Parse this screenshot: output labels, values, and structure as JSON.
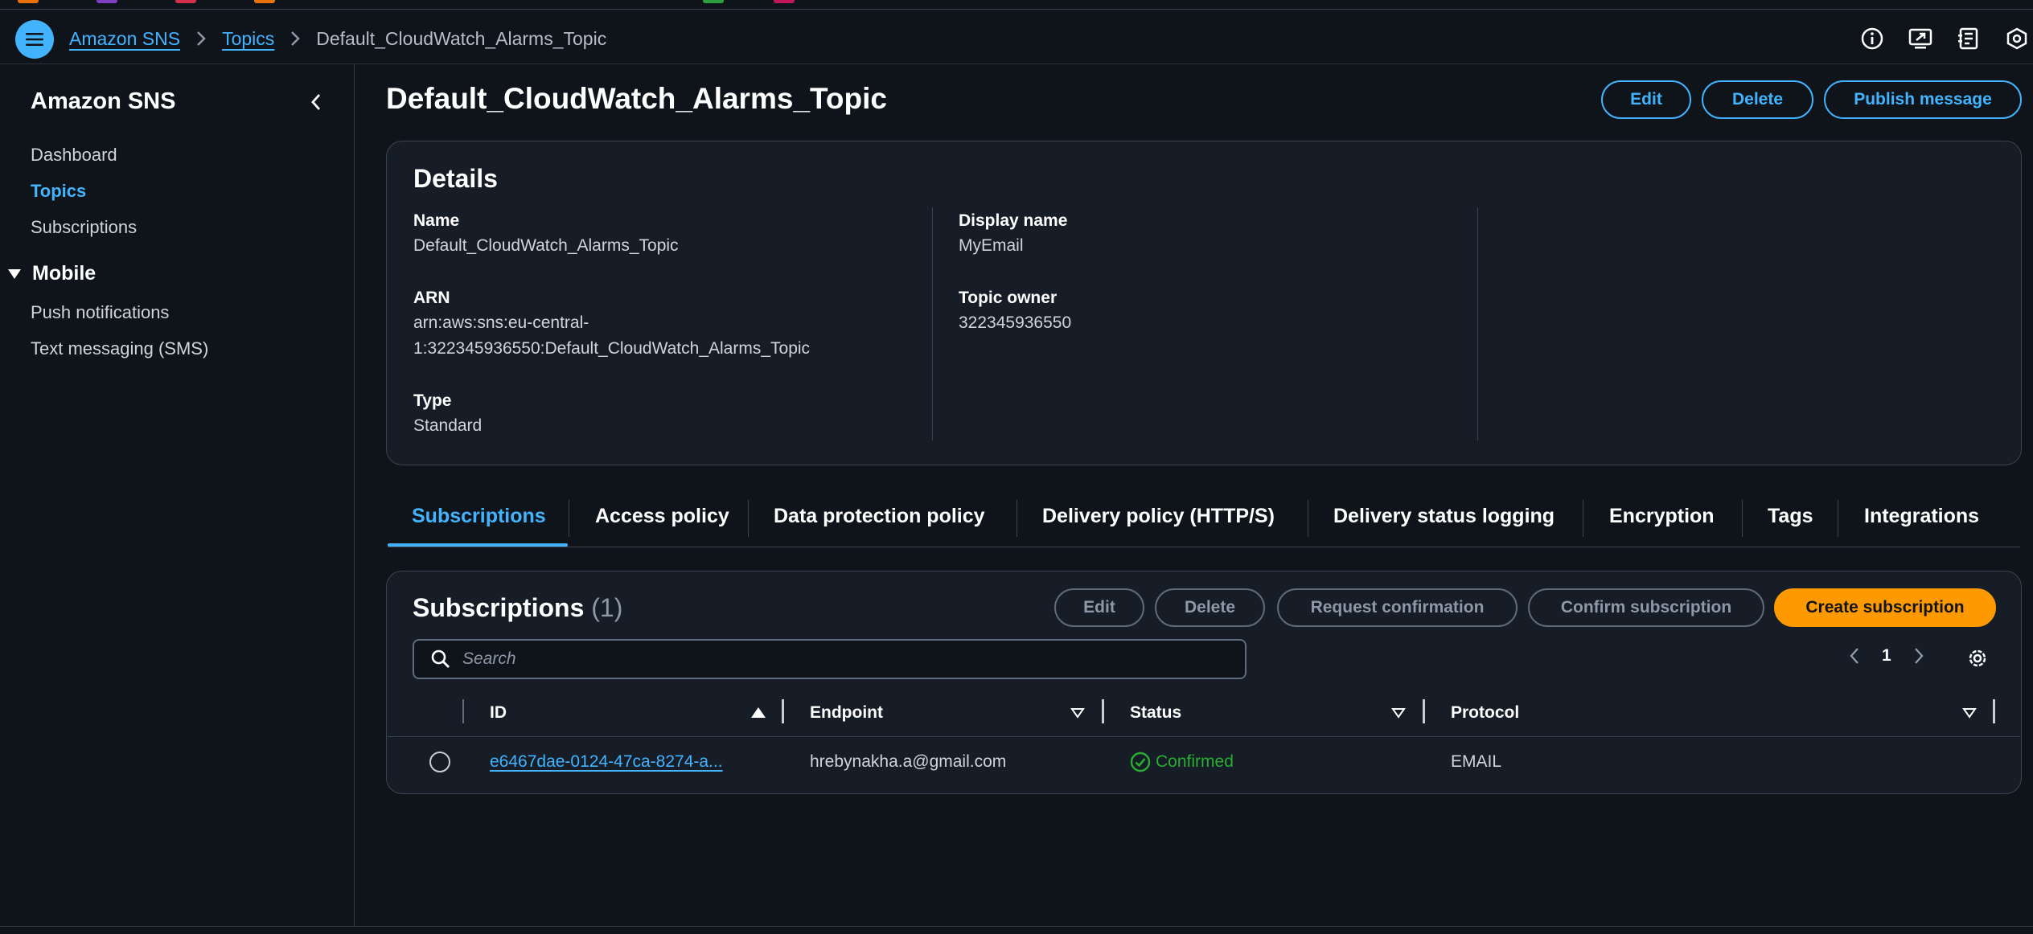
{
  "colors": {
    "accent": "#42b4ff",
    "primary_button": "#ff9900",
    "success": "#29ad32",
    "background": "#0f141a",
    "panel": "#161d26"
  },
  "header": {
    "breadcrumb": {
      "service": "Amazon SNS",
      "topics": "Topics",
      "current": "Default_CloudWatch_Alarms_Topic"
    },
    "icons": [
      "info-icon",
      "screen-share-icon",
      "notes-icon",
      "settings-hex-icon"
    ]
  },
  "sidebar": {
    "title": "Amazon SNS",
    "items": [
      {
        "label": "Dashboard"
      },
      {
        "label": "Topics",
        "active": true
      },
      {
        "label": "Subscriptions"
      }
    ],
    "section": {
      "label": "Mobile",
      "items": [
        {
          "label": "Push notifications"
        },
        {
          "label": "Text messaging (SMS)"
        }
      ]
    }
  },
  "page": {
    "title": "Default_CloudWatch_Alarms_Topic",
    "actions": {
      "edit": "Edit",
      "delete": "Delete",
      "publish": "Publish message"
    }
  },
  "details": {
    "title": "Details",
    "name_label": "Name",
    "name_value": "Default_CloudWatch_Alarms_Topic",
    "arn_label": "ARN",
    "arn_line1": "arn:aws:sns:eu-central-",
    "arn_line2": "1:322345936550:Default_CloudWatch_Alarms_Topic",
    "type_label": "Type",
    "type_value": "Standard",
    "display_name_label": "Display name",
    "display_name_value": "MyEmail",
    "owner_label": "Topic owner",
    "owner_value": "322345936550"
  },
  "tabs": [
    {
      "label": "Subscriptions",
      "active": true
    },
    {
      "label": "Access policy"
    },
    {
      "label": "Data protection policy"
    },
    {
      "label": "Delivery policy (HTTP/S)"
    },
    {
      "label": "Delivery status logging"
    },
    {
      "label": "Encryption"
    },
    {
      "label": "Tags"
    },
    {
      "label": "Integrations"
    }
  ],
  "subscriptions": {
    "title": "Subscriptions",
    "count": "(1)",
    "actions": {
      "edit": "Edit",
      "delete": "Delete",
      "request": "Request confirmation",
      "confirm": "Confirm subscription",
      "create": "Create subscription"
    },
    "search_placeholder": "Search",
    "page": "1",
    "columns": [
      "ID",
      "Endpoint",
      "Status",
      "Protocol"
    ],
    "rows": [
      {
        "id": "e6467dae-0124-47ca-8274-a...",
        "endpoint": "hrebynakha.a@gmail.com",
        "status": "Confirmed",
        "protocol": "EMAIL"
      }
    ]
  }
}
